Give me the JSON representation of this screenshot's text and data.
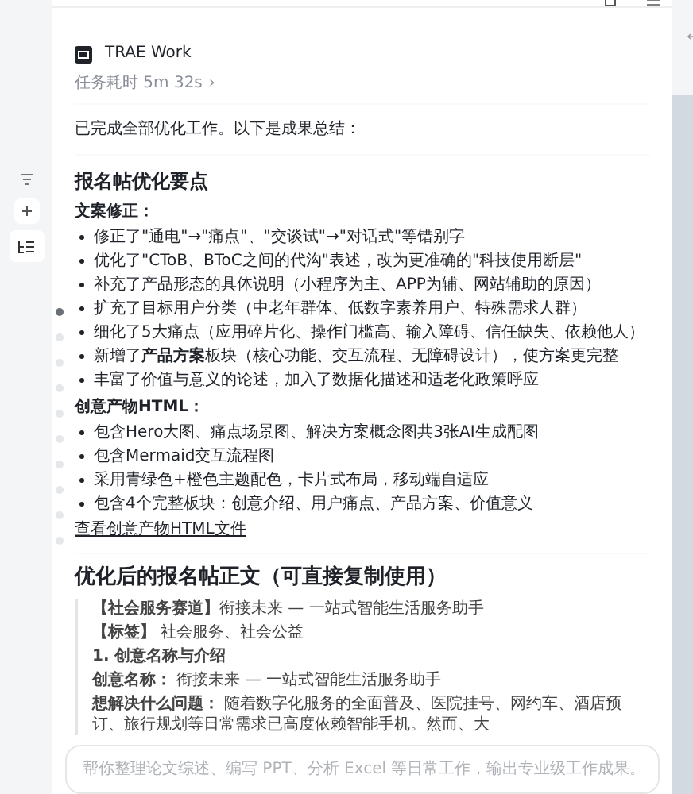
{
  "sidebar_tools": [
    {
      "kind": "filter",
      "selected": false
    },
    {
      "kind": "plus",
      "selected": false
    },
    {
      "kind": "list",
      "selected": true
    }
  ],
  "timeline": [
    {
      "active": true
    },
    {
      "active": false
    },
    {
      "active": false
    },
    {
      "active": false
    },
    {
      "active": false
    },
    {
      "active": false
    },
    {
      "active": false
    },
    {
      "active": false
    },
    {
      "active": false
    },
    {
      "active": false
    }
  ],
  "message": {
    "app": "TRAE Work",
    "duration": "任务耗时 5m 32s",
    "duration_chevron": "›",
    "intro": "已完成全部优化工作。以下是成果总结：",
    "heading": "报名帖优化要点",
    "groups": [
      {
        "title": "文案修正：",
        "items": [
          "修正了\"通电\"→\"痛点\"、\"交谈试\"→\"对话式\"等错别字",
          "优化了\"CToB、BToC之间的代沟\"表述，改为更准确的\"科技使用断层\"",
          "补充了产品形态的具体说明（小程序为主、APP为辅、网站辅助的原因）",
          "扩充了目标用户分类（中老年群体、低数字素养用户、特殊需求人群）",
          "细化了5大痛点（应用碎片化、操作门槛高、输入障碍、信任缺失、依赖他人）",
          "新增了**产品方案**板块（核心功能、交互流程、无障碍设计），使方案更完整",
          "丰富了价值与意义的论述，加入了数据化描述和适老化政策呼应"
        ]
      },
      {
        "title": "创意产物HTML：",
        "items": [
          "包含Hero大图、痛点场景图、解决方案概念图共3张AI生成配图",
          "包含Mermaid交互流程图",
          "采用青绿色+橙色主题配色，卡片式布局，移动端自适应",
          "包含4个完整板块：创意介绍、用户痛点、产品方案、价值意义"
        ]
      }
    ],
    "link": "查看创意产物HTML文件",
    "post_heading": "优化后的报名帖正文（可直接复制使用）",
    "post_lines": [
      {
        "kind": "normal",
        "text": "**【社会服务赛道】**衔接未来 — 一站式智能生活服务助手"
      },
      {
        "kind": "normal",
        "text": "**【标签】** 社会服务、社会公益"
      },
      {
        "kind": "bold",
        "text": "1. 创意名称与介绍"
      },
      {
        "kind": "normal",
        "text": "**创意名称：** 衔接未来 — 一站式智能生活服务助手"
      },
      {
        "kind": "normal",
        "text": "**想解决什么问题：** 随着数字化服务的全面普及、医院挂号、网约车、酒店预订、旅行规划等日常需求已高度依赖智能手机。然而、大"
      }
    ]
  },
  "input": {
    "placeholder": "帮你整理论文综述、编写 PPT、分析 Excel 等日常工作，输出专业级工作成果。"
  }
}
